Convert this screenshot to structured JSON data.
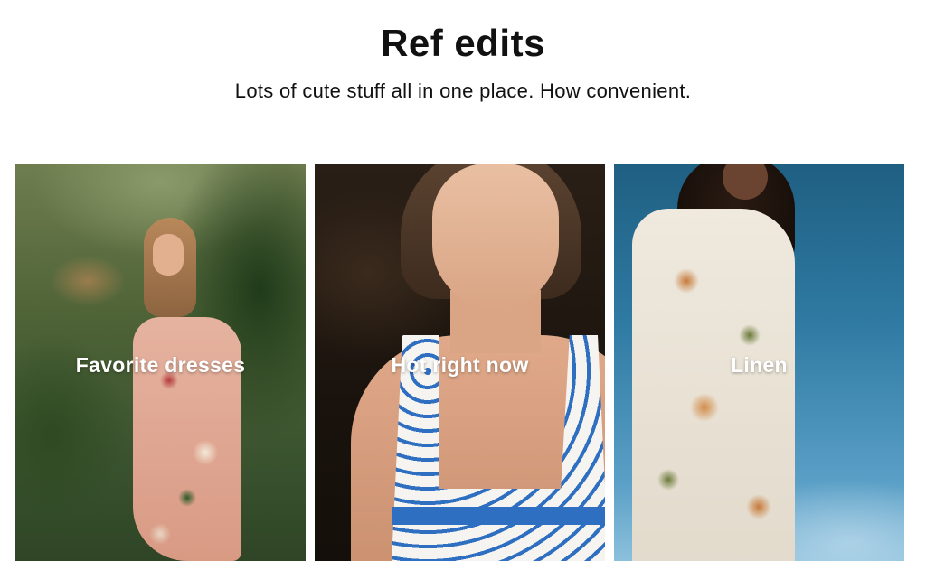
{
  "header": {
    "title": "Ref edits",
    "subtitle": "Lots of cute stuff all in one place. How convenient."
  },
  "cards": [
    {
      "label": "Favorite dresses",
      "image": "woman-in-pink-floral-dress-garden"
    },
    {
      "label": "Hot right now",
      "image": "woman-in-blue-white-floral-dress-portrait"
    },
    {
      "label": "Linen",
      "image": "woman-in-white-floral-linen-dress-blue-sky"
    }
  ]
}
